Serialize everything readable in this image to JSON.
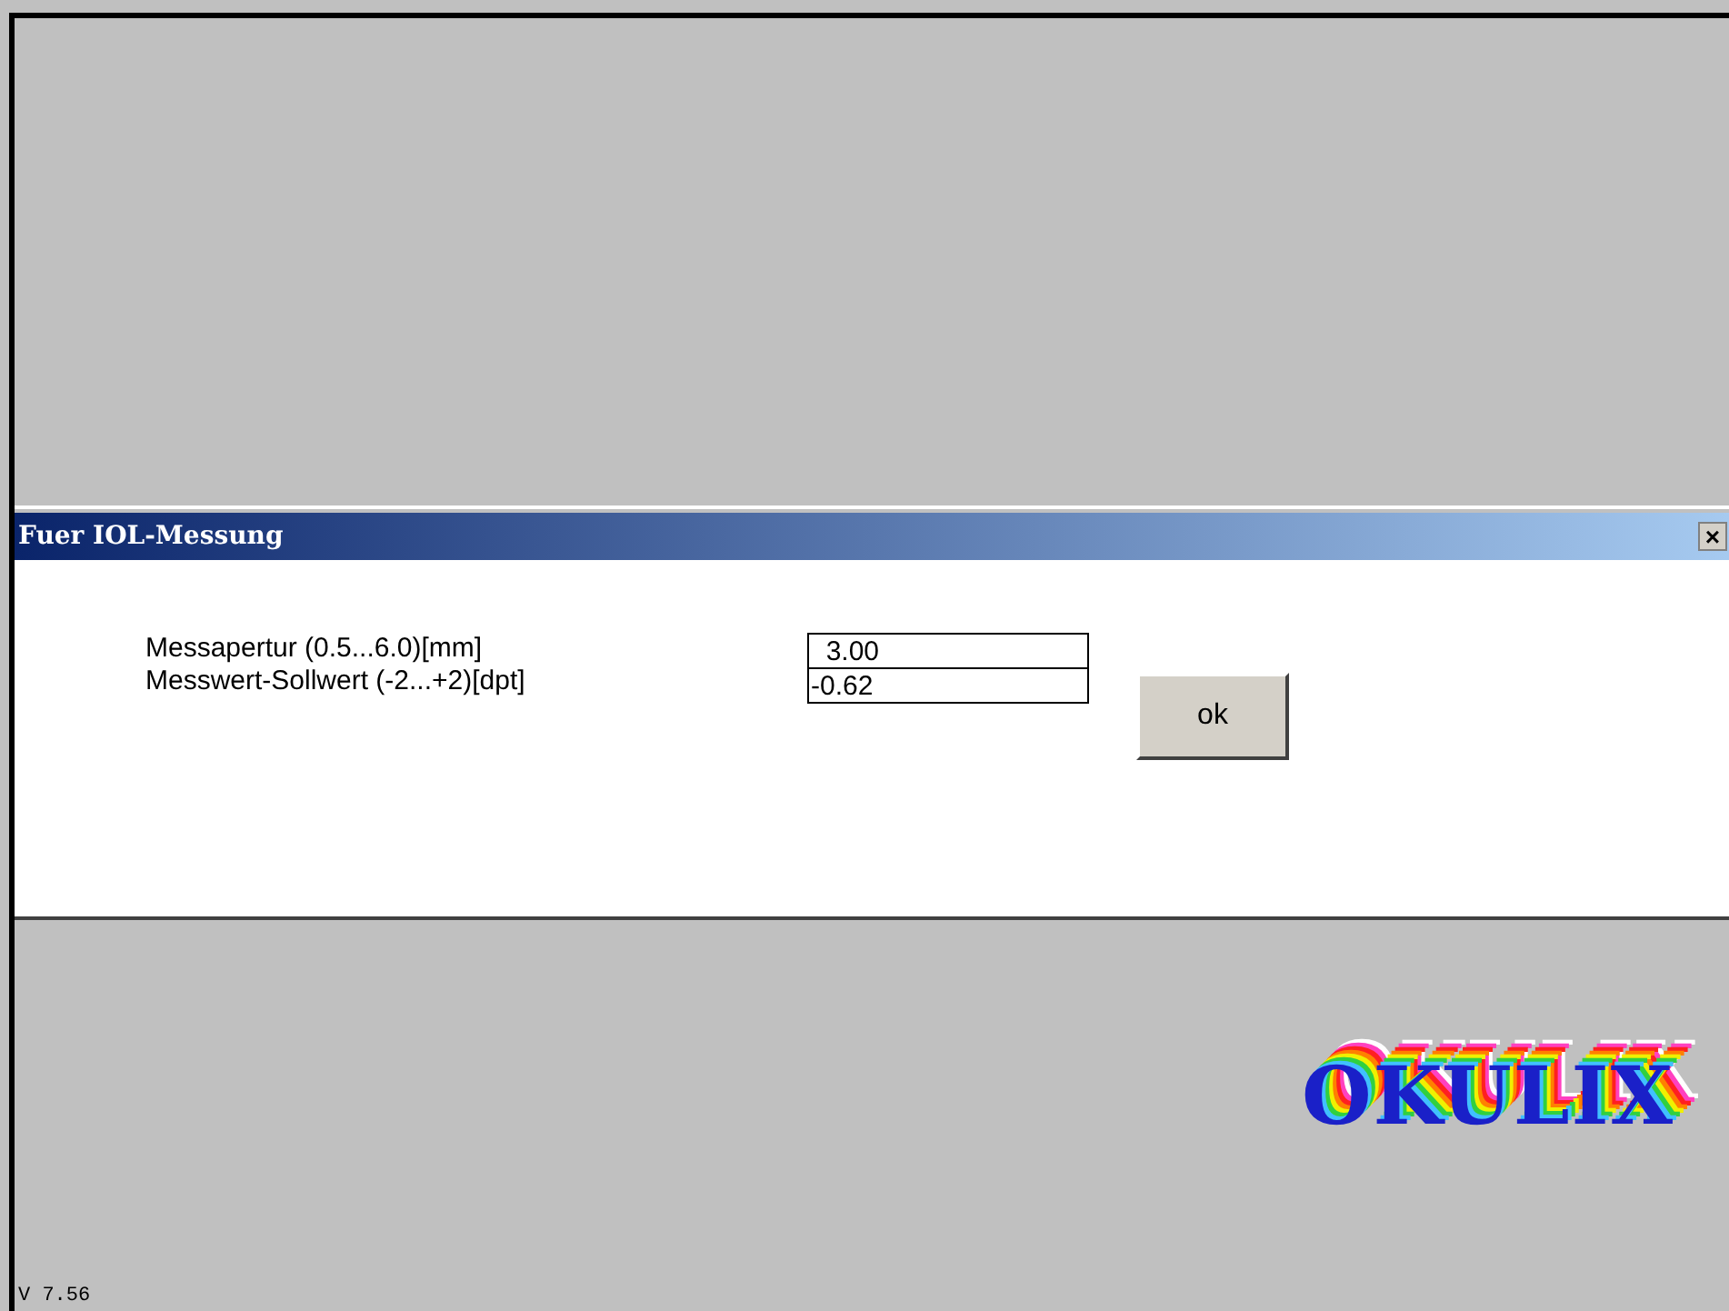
{
  "dialog": {
    "title": "Fuer IOL-Messung",
    "close": "×",
    "fields": [
      {
        "label": "Messapertur (0.5...6.0)[mm]",
        "value": "  3.00"
      },
      {
        "label": "Messwert-Sollwert (-2...+2)[dpt]",
        "value": "-0.62"
      }
    ],
    "button": "ok"
  },
  "logo": "OKULIX",
  "version": "V 7.56"
}
